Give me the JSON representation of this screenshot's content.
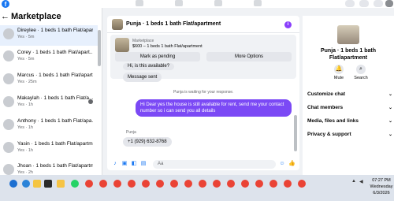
{
  "topbar": {
    "logo": "f"
  },
  "sidebar": {
    "title": "Marketplace",
    "back_icon": "←",
    "items": [
      {
        "name": "Direylee · 1 beds 1 bath Flat/apartm...",
        "sub": "Yes · 5m",
        "active": true
      },
      {
        "name": "Corey · 1 beds 1 bath Flat/apart...",
        "sub": "Yes · 5m",
        "active": false
      },
      {
        "name": "Marcus · 1 beds 1 bath Flat/apart...",
        "sub": "Yes · 25m",
        "active": false
      },
      {
        "name": "Makaylah · 1 beds 1 bath Flat/a...",
        "sub": "Yes · 1h",
        "active": false
      },
      {
        "name": "Anthony · 1 beds 1 bath Flat/apa...",
        "sub": "Yes · 1h",
        "active": false
      },
      {
        "name": "Yasin · 1 beds 1 bath Flat/apartm...",
        "sub": "Yes · 1h",
        "active": false
      },
      {
        "name": "Jhoan · 1 beds 1 bath Flat/apartm...",
        "sub": "Yes · 2h",
        "active": false
      }
    ]
  },
  "chat": {
    "title": "Punja · 1 beds 1 bath Flat/apartment",
    "marketplace_label": "Marketplace",
    "listing": "$600 – 1 beds 1 bath Flat/apartment",
    "mark_pending": "Mark as pending",
    "more_options": "More Options",
    "messages": {
      "in_1": "Hi, is this available?",
      "in_2": "Message sent",
      "system": "Punja is waiting for your response.",
      "out_1": "Hi Dear yes the house is still available for rent, send me your contact number so i can send you all details",
      "sender": "Punja",
      "in_3": "+1 (929) 632-8768"
    },
    "composer_placeholder": "Aa"
  },
  "right_panel": {
    "name": "Punja · 1 beds 1 bath Flat/apartment",
    "mute": "Mute",
    "search": "Search",
    "rows": [
      "Customize chat",
      "Chat members",
      "Media, files and links",
      "Privacy & support"
    ]
  },
  "taskbar": {
    "time": "07:27 PM",
    "day": "Wednesday",
    "date": "6/3/2026"
  }
}
